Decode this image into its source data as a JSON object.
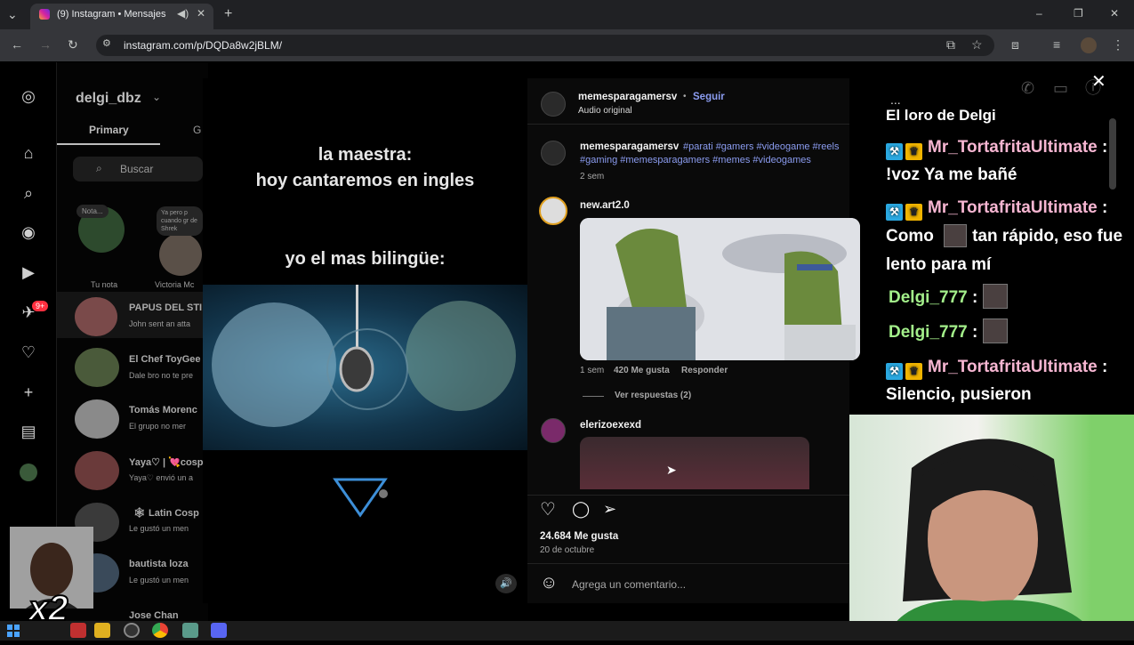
{
  "browser": {
    "tab_title": "(9) Instagram • Mensajes",
    "url": "instagram.com/p/DQDa8w2jBLM/",
    "new_tab_symbol": "+",
    "window_buttons": [
      "–",
      "❐",
      "✕"
    ]
  },
  "instagram": {
    "account_name": "delgi_dbz",
    "tabs": [
      "Primary",
      "G"
    ],
    "search_placeholder": "Buscar",
    "notes": [
      {
        "bubble": "Nota...",
        "label": "Tu nota"
      },
      {
        "bubble": "Ya pero p cuando gr de Shrek",
        "label": "Victoria Mc"
      }
    ],
    "notification_badge": "9+",
    "conversations": [
      {
        "name": "PAPUS DEL STI",
        "preview": "John sent an atta"
      },
      {
        "name": "El Chef ToyGee",
        "preview": "Dale bro no te pre"
      },
      {
        "name": "Tomás Morenc",
        "preview": "El grupo no mer"
      },
      {
        "name": "Yaya♡ | 💘cosp",
        "preview": "Yaya♡ envió un a"
      },
      {
        "name": "🕸 Latin Cosp",
        "preview": "Le gustó un men"
      },
      {
        "name": "bautista loza",
        "preview": "Le gustó un men"
      },
      {
        "name": "Jose Chan",
        "preview": ""
      }
    ]
  },
  "reel": {
    "line1": "la maestra:",
    "line2": "hoy cantaremos en ingles",
    "line3": "yo el mas bilingüe:"
  },
  "post": {
    "author": "memesparagamersv",
    "follow": "Seguir",
    "audio": "Audio original",
    "caption_tags_line1": "#parati #gamers #videogame #reels",
    "caption_tags_line2": "#gaming #memesparagamers #memes #videogames",
    "caption_age": "2 sem",
    "comment1": {
      "author": "new.art2.0",
      "age": "1 sem",
      "likes": "420 Me gusta",
      "reply": "Responder",
      "view_replies": "Ver respuestas (2)"
    },
    "comment2": {
      "author": "elerizoexexd"
    },
    "likes_total": "24.684 Me gusta",
    "date": "20 de octubre",
    "comment_placeholder": "Agrega un comentario...",
    "more": "..."
  },
  "chat": {
    "header_partial": "El loro de Delgi",
    "lines": [
      {
        "user": "Mr_TortafritaUltimate",
        "sep": " :",
        "msg": "!voz Ya me bañé"
      },
      {
        "user": "Mr_TortafritaUltimate",
        "sep": " :",
        "msg_a": "Como",
        "msg_b": "tan rápido, eso fue",
        "msg_c": "lento para mí"
      },
      {
        "user": "Delgi_777",
        "sep": " :"
      },
      {
        "user": "Delgi_777",
        "sep": " :"
      },
      {
        "user": "Mr_TortafritaUltimate",
        "sep": " :",
        "msg": "Silencio, pusieron"
      }
    ]
  },
  "overlay": {
    "multiplier": "x2"
  },
  "colors": {
    "follow_blue": "#8b9cf0",
    "chat_pink": "#f7b6d2",
    "chat_green": "#a3ef8a"
  }
}
